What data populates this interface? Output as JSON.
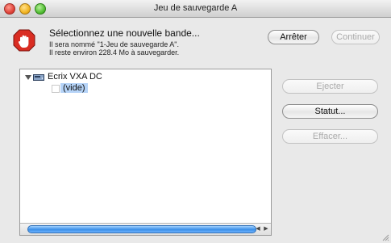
{
  "window": {
    "title": "Jeu de sauvegarde A"
  },
  "message": {
    "main": "Sélectionnez une nouvelle bande...",
    "line1": "Il sera nommé \"1-Jeu de sauvegarde A\".",
    "line2": "Il reste environ 228.4 Mo à sauvegarder."
  },
  "buttons": {
    "stop_label": "Arrêter",
    "continue_label": "Continuer",
    "eject_label": "Ejecter",
    "status_label": "Statut...",
    "erase_label": "Effacer..."
  },
  "tree": {
    "device_label": "Ecrix VXA DC",
    "empty_label": "(vide)"
  },
  "scroll": {
    "left_arrow": "◀",
    "right_arrow": "▶"
  },
  "icons": {
    "stop": "stop-hand-icon",
    "drive": "tape-drive-icon",
    "grip": "resize-grip-icon"
  }
}
